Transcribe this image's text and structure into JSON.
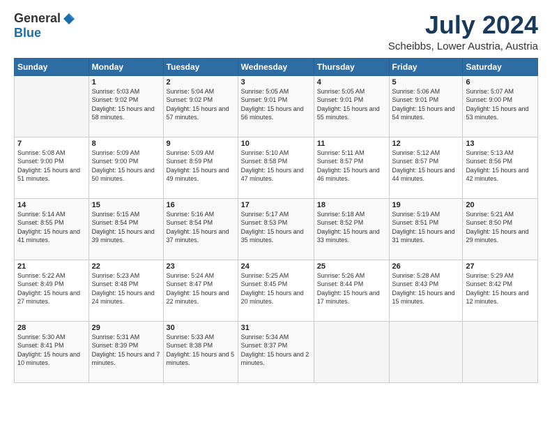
{
  "header": {
    "logo_general": "General",
    "logo_blue": "Blue",
    "month_title": "July 2024",
    "location": "Scheibbs, Lower Austria, Austria"
  },
  "weekdays": [
    "Sunday",
    "Monday",
    "Tuesday",
    "Wednesday",
    "Thursday",
    "Friday",
    "Saturday"
  ],
  "weeks": [
    [
      {
        "day": "",
        "sunrise": "",
        "sunset": "",
        "daylight": ""
      },
      {
        "day": "1",
        "sunrise": "Sunrise: 5:03 AM",
        "sunset": "Sunset: 9:02 PM",
        "daylight": "Daylight: 15 hours and 58 minutes."
      },
      {
        "day": "2",
        "sunrise": "Sunrise: 5:04 AM",
        "sunset": "Sunset: 9:02 PM",
        "daylight": "Daylight: 15 hours and 57 minutes."
      },
      {
        "day": "3",
        "sunrise": "Sunrise: 5:05 AM",
        "sunset": "Sunset: 9:01 PM",
        "daylight": "Daylight: 15 hours and 56 minutes."
      },
      {
        "day": "4",
        "sunrise": "Sunrise: 5:05 AM",
        "sunset": "Sunset: 9:01 PM",
        "daylight": "Daylight: 15 hours and 55 minutes."
      },
      {
        "day": "5",
        "sunrise": "Sunrise: 5:06 AM",
        "sunset": "Sunset: 9:01 PM",
        "daylight": "Daylight: 15 hours and 54 minutes."
      },
      {
        "day": "6",
        "sunrise": "Sunrise: 5:07 AM",
        "sunset": "Sunset: 9:00 PM",
        "daylight": "Daylight: 15 hours and 53 minutes."
      }
    ],
    [
      {
        "day": "7",
        "sunrise": "Sunrise: 5:08 AM",
        "sunset": "Sunset: 9:00 PM",
        "daylight": "Daylight: 15 hours and 51 minutes."
      },
      {
        "day": "8",
        "sunrise": "Sunrise: 5:09 AM",
        "sunset": "Sunset: 9:00 PM",
        "daylight": "Daylight: 15 hours and 50 minutes."
      },
      {
        "day": "9",
        "sunrise": "Sunrise: 5:09 AM",
        "sunset": "Sunset: 8:59 PM",
        "daylight": "Daylight: 15 hours and 49 minutes."
      },
      {
        "day": "10",
        "sunrise": "Sunrise: 5:10 AM",
        "sunset": "Sunset: 8:58 PM",
        "daylight": "Daylight: 15 hours and 47 minutes."
      },
      {
        "day": "11",
        "sunrise": "Sunrise: 5:11 AM",
        "sunset": "Sunset: 8:57 PM",
        "daylight": "Daylight: 15 hours and 46 minutes."
      },
      {
        "day": "12",
        "sunrise": "Sunrise: 5:12 AM",
        "sunset": "Sunset: 8:57 PM",
        "daylight": "Daylight: 15 hours and 44 minutes."
      },
      {
        "day": "13",
        "sunrise": "Sunrise: 5:13 AM",
        "sunset": "Sunset: 8:56 PM",
        "daylight": "Daylight: 15 hours and 42 minutes."
      }
    ],
    [
      {
        "day": "14",
        "sunrise": "Sunrise: 5:14 AM",
        "sunset": "Sunset: 8:55 PM",
        "daylight": "Daylight: 15 hours and 41 minutes."
      },
      {
        "day": "15",
        "sunrise": "Sunrise: 5:15 AM",
        "sunset": "Sunset: 8:54 PM",
        "daylight": "Daylight: 15 hours and 39 minutes."
      },
      {
        "day": "16",
        "sunrise": "Sunrise: 5:16 AM",
        "sunset": "Sunset: 8:54 PM",
        "daylight": "Daylight: 15 hours and 37 minutes."
      },
      {
        "day": "17",
        "sunrise": "Sunrise: 5:17 AM",
        "sunset": "Sunset: 8:53 PM",
        "daylight": "Daylight: 15 hours and 35 minutes."
      },
      {
        "day": "18",
        "sunrise": "Sunrise: 5:18 AM",
        "sunset": "Sunset: 8:52 PM",
        "daylight": "Daylight: 15 hours and 33 minutes."
      },
      {
        "day": "19",
        "sunrise": "Sunrise: 5:19 AM",
        "sunset": "Sunset: 8:51 PM",
        "daylight": "Daylight: 15 hours and 31 minutes."
      },
      {
        "day": "20",
        "sunrise": "Sunrise: 5:21 AM",
        "sunset": "Sunset: 8:50 PM",
        "daylight": "Daylight: 15 hours and 29 minutes."
      }
    ],
    [
      {
        "day": "21",
        "sunrise": "Sunrise: 5:22 AM",
        "sunset": "Sunset: 8:49 PM",
        "daylight": "Daylight: 15 hours and 27 minutes."
      },
      {
        "day": "22",
        "sunrise": "Sunrise: 5:23 AM",
        "sunset": "Sunset: 8:48 PM",
        "daylight": "Daylight: 15 hours and 24 minutes."
      },
      {
        "day": "23",
        "sunrise": "Sunrise: 5:24 AM",
        "sunset": "Sunset: 8:47 PM",
        "daylight": "Daylight: 15 hours and 22 minutes."
      },
      {
        "day": "24",
        "sunrise": "Sunrise: 5:25 AM",
        "sunset": "Sunset: 8:45 PM",
        "daylight": "Daylight: 15 hours and 20 minutes."
      },
      {
        "day": "25",
        "sunrise": "Sunrise: 5:26 AM",
        "sunset": "Sunset: 8:44 PM",
        "daylight": "Daylight: 15 hours and 17 minutes."
      },
      {
        "day": "26",
        "sunrise": "Sunrise: 5:28 AM",
        "sunset": "Sunset: 8:43 PM",
        "daylight": "Daylight: 15 hours and 15 minutes."
      },
      {
        "day": "27",
        "sunrise": "Sunrise: 5:29 AM",
        "sunset": "Sunset: 8:42 PM",
        "daylight": "Daylight: 15 hours and 12 minutes."
      }
    ],
    [
      {
        "day": "28",
        "sunrise": "Sunrise: 5:30 AM",
        "sunset": "Sunset: 8:41 PM",
        "daylight": "Daylight: 15 hours and 10 minutes."
      },
      {
        "day": "29",
        "sunrise": "Sunrise: 5:31 AM",
        "sunset": "Sunset: 8:39 PM",
        "daylight": "Daylight: 15 hours and 7 minutes."
      },
      {
        "day": "30",
        "sunrise": "Sunrise: 5:33 AM",
        "sunset": "Sunset: 8:38 PM",
        "daylight": "Daylight: 15 hours and 5 minutes."
      },
      {
        "day": "31",
        "sunrise": "Sunrise: 5:34 AM",
        "sunset": "Sunset: 8:37 PM",
        "daylight": "Daylight: 15 hours and 2 minutes."
      },
      {
        "day": "",
        "sunrise": "",
        "sunset": "",
        "daylight": ""
      },
      {
        "day": "",
        "sunrise": "",
        "sunset": "",
        "daylight": ""
      },
      {
        "day": "",
        "sunrise": "",
        "sunset": "",
        "daylight": ""
      }
    ]
  ]
}
